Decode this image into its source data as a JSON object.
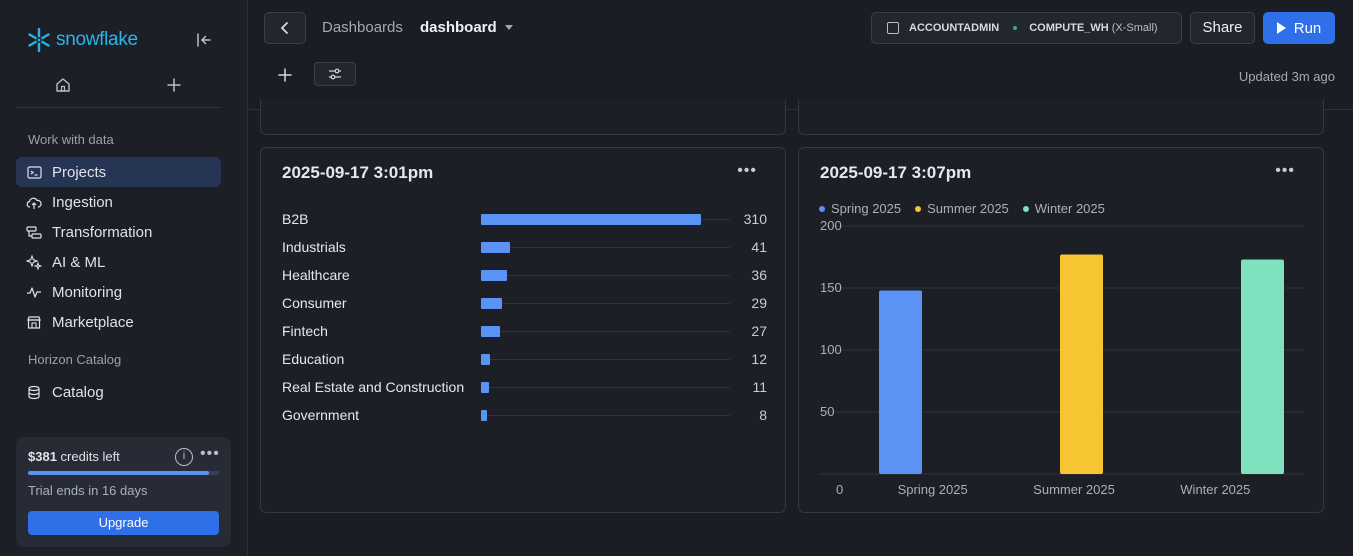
{
  "sidebar": {
    "logo_text": "snowflake",
    "section_work": "Work with data",
    "section_horizon": "Horizon Catalog",
    "items": [
      {
        "label": "Projects",
        "icon": "terminal-icon"
      },
      {
        "label": "Ingestion",
        "icon": "cloud-upload-icon"
      },
      {
        "label": "Transformation",
        "icon": "transform-icon"
      },
      {
        "label": "AI & ML",
        "icon": "sparkle-icon"
      },
      {
        "label": "Monitoring",
        "icon": "activity-icon"
      },
      {
        "label": "Marketplace",
        "icon": "store-icon"
      }
    ],
    "catalog_item": {
      "label": "Catalog",
      "icon": "database-icon"
    },
    "credits": {
      "amount": "$381",
      "suffix": "credits left",
      "fraction": 0.95,
      "trial_text": "Trial ends in 16 days",
      "upgrade_label": "Upgrade"
    }
  },
  "header": {
    "breadcrumb_parent": "Dashboards",
    "breadcrumb_current": "dashboard",
    "role": "ACCOUNTADMIN",
    "warehouse": "COMPUTE_WH",
    "warehouse_size": "(X-Small)",
    "share_label": "Share",
    "run_label": "Run",
    "updated_text": "Updated 3m ago"
  },
  "colors": {
    "accent": "#2f6fe8",
    "bar_blue": "#5b93f5",
    "bar_yellow": "#f7c531",
    "bar_green": "#7ee2bf"
  },
  "chart_data": [
    {
      "type": "bar",
      "orientation": "horizontal",
      "title": "2025-09-17 3:01pm",
      "categories": [
        "B2B",
        "Industrials",
        "Healthcare",
        "Consumer",
        "Fintech",
        "Education",
        "Real Estate and Construction",
        "Government"
      ],
      "values": [
        310,
        41,
        36,
        29,
        27,
        12,
        11,
        8
      ]
    },
    {
      "type": "bar",
      "title": "2025-09-17 3:07pm",
      "categories": [
        "Spring 2025",
        "Summer 2025",
        "Winter 2025"
      ],
      "series": [
        {
          "name": "Spring 2025",
          "values": [
            148,
            null,
            null
          ]
        },
        {
          "name": "Summer 2025",
          "values": [
            null,
            177,
            null
          ]
        },
        {
          "name": "Winter 2025",
          "values": [
            null,
            null,
            173
          ]
        }
      ],
      "yticks": [
        0,
        50,
        100,
        150,
        200
      ],
      "ylim": [
        0,
        210
      ],
      "grid": true,
      "legend_position": "top-left"
    }
  ]
}
